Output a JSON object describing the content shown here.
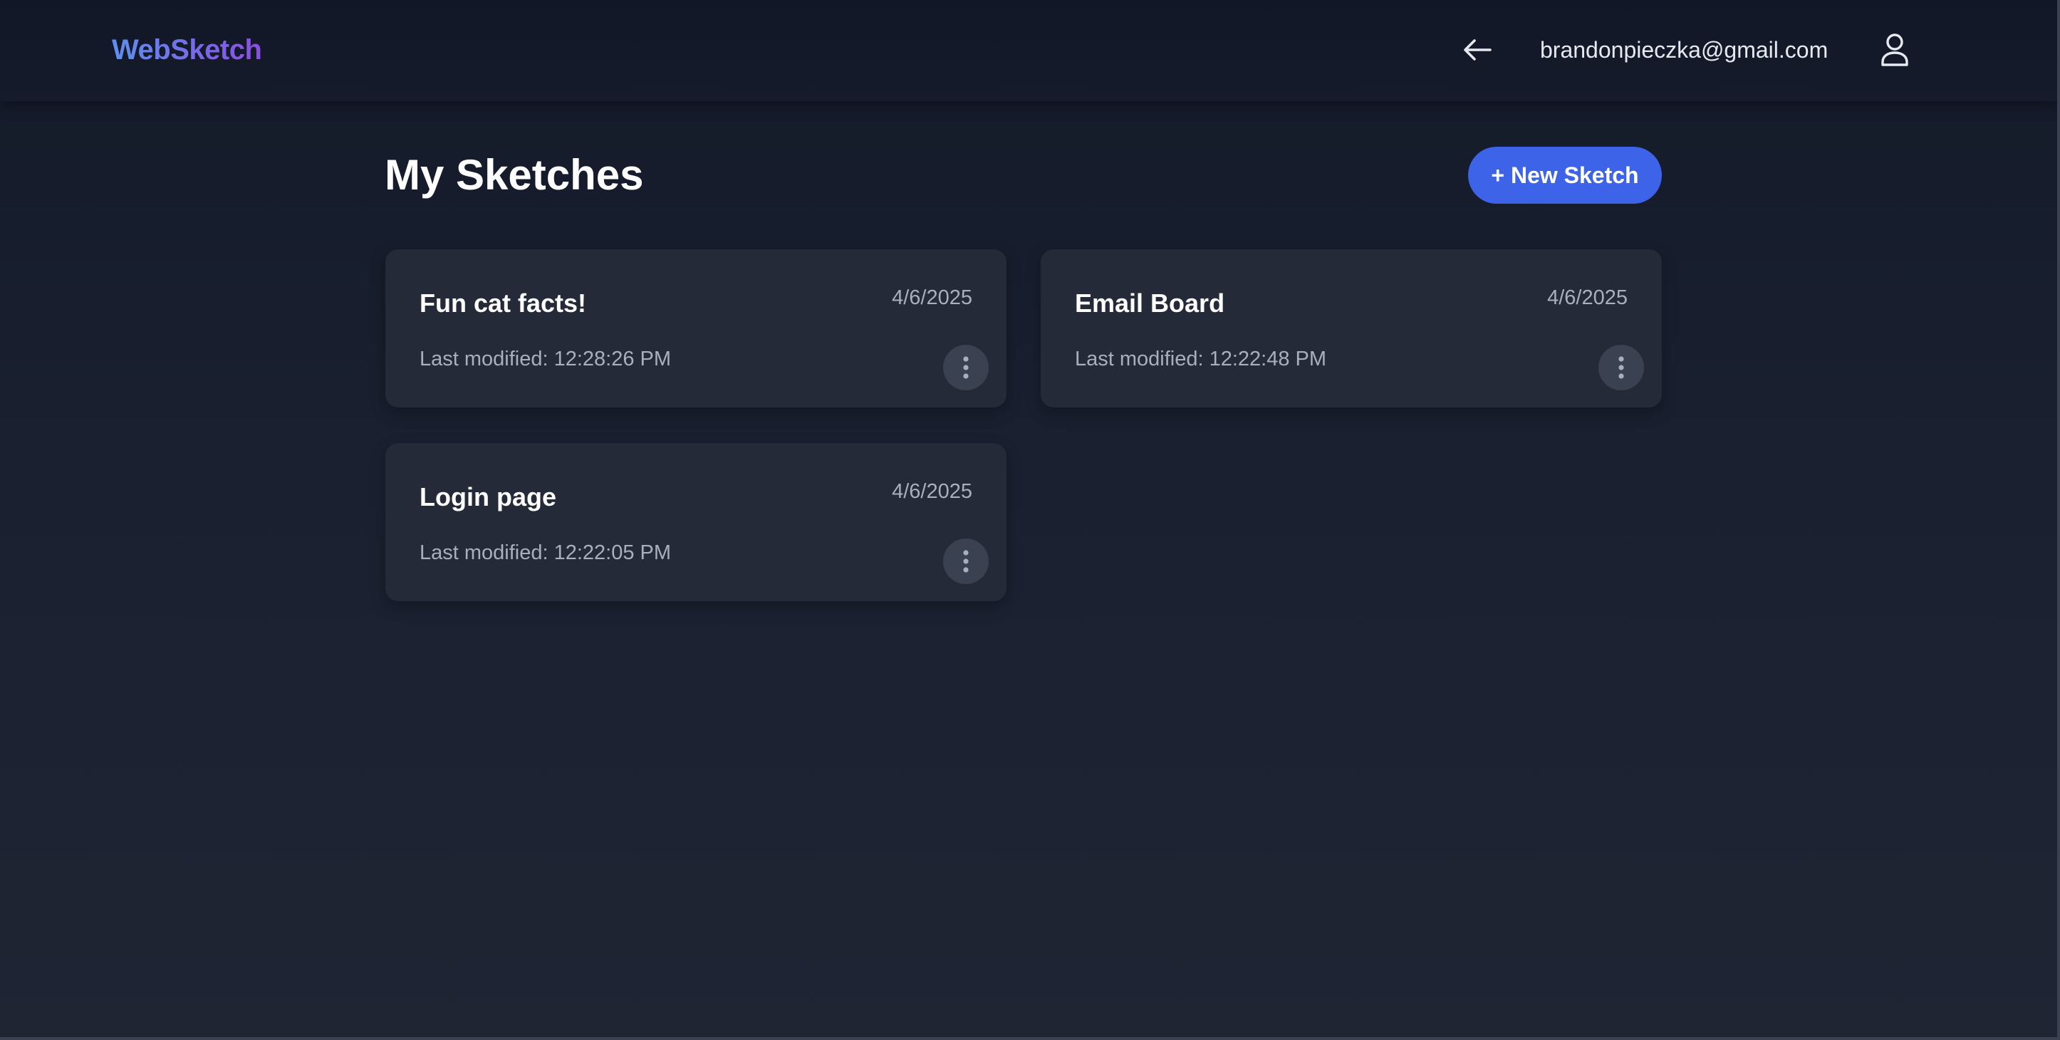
{
  "header": {
    "logo": "WebSketch",
    "user_email": "brandonpieczka@gmail.com",
    "icons": {
      "back": "arrow-left-icon",
      "user": "user-icon"
    }
  },
  "main": {
    "title": "My Sketches",
    "new_sketch_label": "+ New Sketch",
    "sketches": [
      {
        "title": "Fun cat facts!",
        "date": "4/6/2025",
        "modified": "Last modified: 12:28:26 PM"
      },
      {
        "title": "Email Board",
        "date": "4/6/2025",
        "modified": "Last modified: 12:22:48 PM"
      },
      {
        "title": "Login page",
        "date": "4/6/2025",
        "modified": "Last modified: 12:22:05 PM"
      }
    ]
  },
  "colors": {
    "background": "#1a2030",
    "card": "#242a38",
    "primary_button": "#3d63e8",
    "logo_gradient_start": "#5f8fee",
    "logo_gradient_end": "#8a4fe0",
    "muted_text": "#a8afbd"
  }
}
